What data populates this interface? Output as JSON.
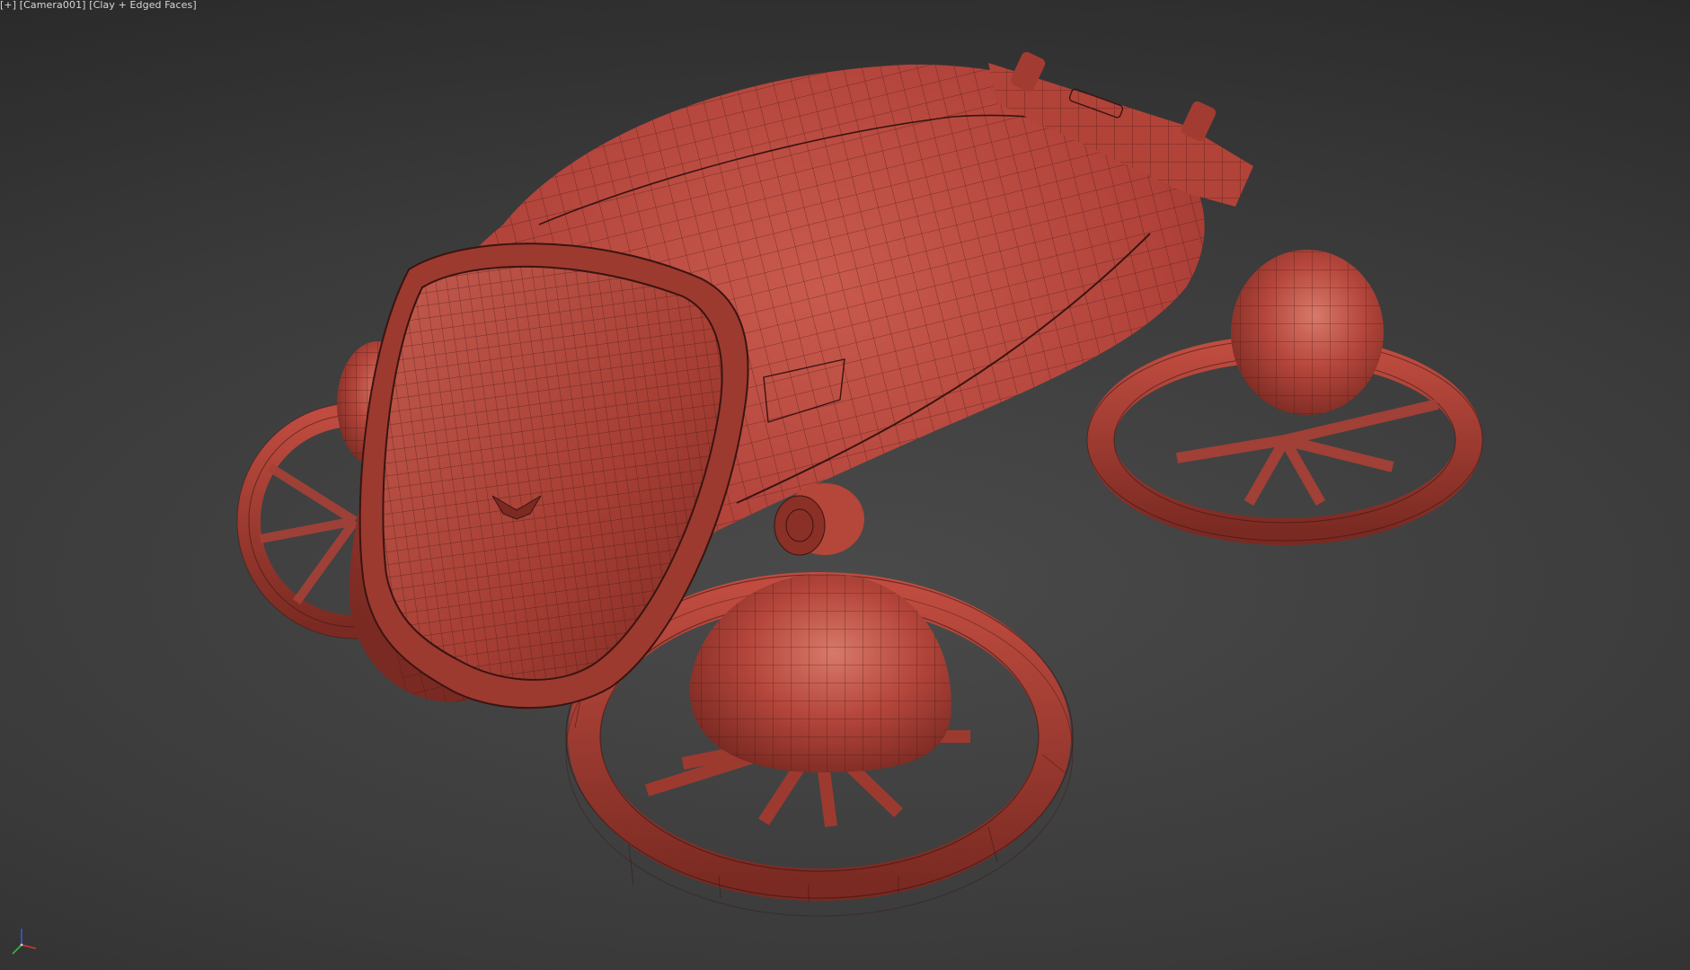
{
  "viewport": {
    "label_parts": {
      "view_menu": "[+]",
      "camera": "[Camera001]",
      "shading": "[Clay + Edged Faces]"
    },
    "model": {
      "object": "drone-vehicle",
      "shading": "clay",
      "edged_faces": true,
      "colors": {
        "clay": "#b8453a",
        "clay_light": "#d06a5c",
        "clay_dark": "#7c2a22",
        "wire": "#3a1410",
        "background_center": "#4a4a4a",
        "background_edge": "#1e1e1e"
      }
    },
    "gizmo": {
      "axes": [
        "x",
        "y",
        "z"
      ],
      "colors": {
        "x": "#d23a2a",
        "y": "#3ab23a",
        "z": "#3a5ad2"
      }
    }
  }
}
